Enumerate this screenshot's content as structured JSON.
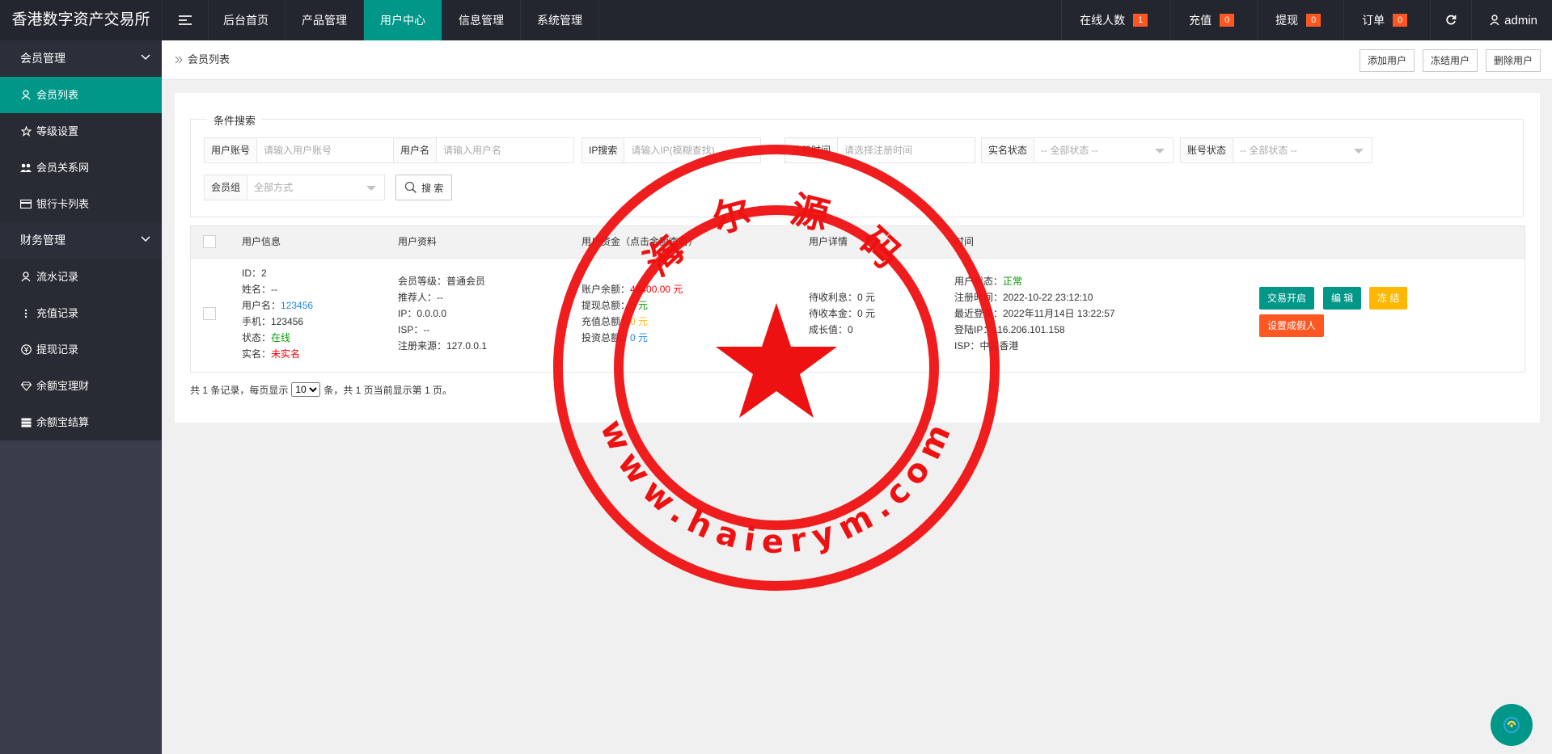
{
  "app": {
    "title": "香港数字资产交易所",
    "nav": [
      "后台首页",
      "产品管理",
      "用户中心",
      "信息管理",
      "系统管理"
    ],
    "stats": [
      {
        "label": "在线人数",
        "count": "1"
      },
      {
        "label": "充值",
        "count": "0"
      },
      {
        "label": "提现",
        "count": "0"
      },
      {
        "label": "订单",
        "count": "0"
      }
    ],
    "user": "admin",
    "accent": "#009688"
  },
  "sidebar": {
    "group1": "会员管理",
    "items1": [
      "会员列表",
      "等级设置",
      "会员关系网",
      "银行卡列表"
    ],
    "group2": "财务管理",
    "items2": [
      "流水记录",
      "充值记录",
      "提现记录",
      "余额宝理财",
      "余额宝结算"
    ]
  },
  "breadcrumb": {
    "current": "会员列表",
    "actions": [
      "添加用户",
      "冻结用户",
      "删除用户"
    ]
  },
  "filters": {
    "legend": "条件搜索",
    "account": {
      "label": "用户账号",
      "placeholder": "请输入用户账号"
    },
    "username": {
      "label": "用户名",
      "placeholder": "请输入用户名"
    },
    "ip": {
      "label": "IP搜索",
      "placeholder": "请输入IP(模糊查找)"
    },
    "regtime": {
      "label": "注册时间",
      "placeholder": "请选择注册时间"
    },
    "realname": {
      "label": "实名状态",
      "value": "-- 全部状态 --"
    },
    "acctstatus": {
      "label": "账号状态",
      "value": "-- 全部状态 --"
    },
    "group": {
      "label": "会员组",
      "value": "全部方式"
    },
    "search_label": "搜 索"
  },
  "table": {
    "headers": [
      "用户信息",
      "用户资料",
      "用户资金（点击金额查看）",
      "用户详情",
      "时间"
    ],
    "row": {
      "info": {
        "id": "ID：2",
        "name": "姓名：--",
        "username_prefix": "用户名：",
        "username": "123456",
        "phone": "手机：123456",
        "status_prefix": "状态：",
        "status": "在线",
        "real_prefix": "实名：",
        "real": "未实名"
      },
      "profile": [
        "会员等级：普通会员",
        "推荐人：--",
        "IP：0.0.0.0",
        "ISP：--",
        "注册来源：127.0.0.1"
      ],
      "funds": {
        "balance_prefix": "账户余额：",
        "balance": "48400.00 元",
        "withdraw_prefix": "提现总额：",
        "withdraw": "0 元",
        "recharge_prefix": "充值总额：",
        "recharge": "0 元",
        "invest_prefix": "投资总额：",
        "invest": "0 元"
      },
      "details": [
        "待收利息：0 元",
        "待收本金：0 元",
        "成长值：0"
      ],
      "time": {
        "state_prefix": "用户状态：",
        "state": "正常",
        "reg": "注册时间：2022-10-22 23:12:10",
        "login": "最近登录：2022年11月14日 13:22:57",
        "login_ip": "登陆IP：116.206.101.158",
        "isp": "ISP：中国香港"
      },
      "actions": {
        "trade": "交易开启",
        "edit": "编 辑",
        "freeze": "冻 结",
        "fake": "设置成假人"
      }
    }
  },
  "pager": {
    "prefix": "共 1 条记录，每页显示",
    "per_page": "10",
    "suffix": "条，共 1 页当前显示第 1 页。"
  },
  "watermark": {
    "top": "海 尔 源 码",
    "bottom": "www.haierym.com",
    "color": "#ee1111"
  }
}
